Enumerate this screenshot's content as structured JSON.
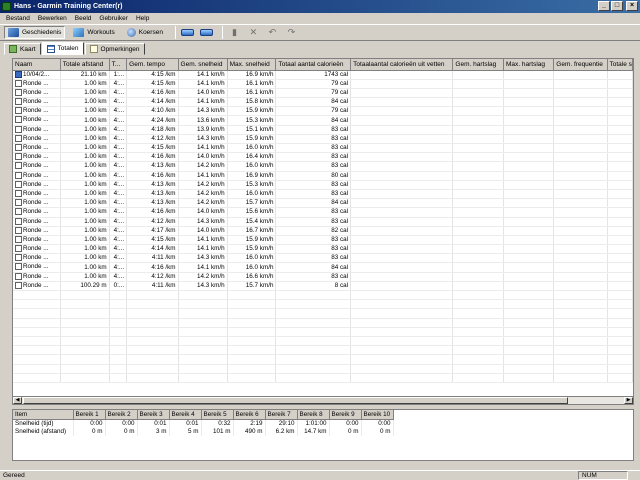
{
  "window": {
    "title": "Hans - Garmin Training Center(r)"
  },
  "menu": [
    "Bestand",
    "Bewerken",
    "Beeld",
    "Gebruiker",
    "Help"
  ],
  "toolbar": {
    "history": "Geschiedenis",
    "workouts": "Workouts",
    "courses": "Koersen"
  },
  "subtabs": [
    "Kaart",
    "Totalen",
    "Opmerkingen"
  ],
  "lap_table": {
    "columns": [
      "Naam",
      "Totale afstand",
      "T...",
      "Gem. tempo",
      "Gem. snelheid",
      "Max. snelheid",
      "Totaal aantal calorieën",
      "Totaalaantal calorieën uit vetten",
      "Gem. hartslag",
      "Max. hartslag",
      "Gem. frequentie",
      "Totale s"
    ],
    "rows": [
      [
        "10/04/2...",
        "21.10 km",
        "1:...",
        "4:15 /km",
        "14.1 km/h",
        "16.9 km/h",
        "1743 cal"
      ],
      [
        "Ronde ...",
        "1.00 km",
        "4:...",
        "4:15 /km",
        "14.1 km/h",
        "16.1 km/h",
        "79 cal"
      ],
      [
        "Ronde ...",
        "1.00 km",
        "4:...",
        "4:16 /km",
        "14.0 km/h",
        "16.1 km/h",
        "79 cal"
      ],
      [
        "Ronde ...",
        "1.00 km",
        "4:...",
        "4:14 /km",
        "14.1 km/h",
        "15.8 km/h",
        "84 cal"
      ],
      [
        "Ronde ...",
        "1.00 km",
        "4:...",
        "4:10 /km",
        "14.3 km/h",
        "15.9 km/h",
        "79 cal"
      ],
      [
        "Ronde ...",
        "1.00 km",
        "4:...",
        "4:24 /km",
        "13.6 km/h",
        "15.3 km/h",
        "84 cal"
      ],
      [
        "Ronde ...",
        "1.00 km",
        "4:...",
        "4:18 /km",
        "13.9 km/h",
        "15.1 km/h",
        "83 cal"
      ],
      [
        "Ronde ...",
        "1.00 km",
        "4:...",
        "4:12 /km",
        "14.3 km/h",
        "15.9 km/h",
        "83 cal"
      ],
      [
        "Ronde ...",
        "1.00 km",
        "4:...",
        "4:15 /km",
        "14.1 km/h",
        "16.0 km/h",
        "83 cal"
      ],
      [
        "Ronde ...",
        "1.00 km",
        "4:...",
        "4:16 /km",
        "14.0 km/h",
        "16.4 km/h",
        "83 cal"
      ],
      [
        "Ronde ...",
        "1.00 km",
        "4:...",
        "4:13 /km",
        "14.2 km/h",
        "16.0 km/h",
        "83 cal"
      ],
      [
        "Ronde ...",
        "1.00 km",
        "4:...",
        "4:16 /km",
        "14.1 km/h",
        "16.9 km/h",
        "80 cal"
      ],
      [
        "Ronde ...",
        "1.00 km",
        "4:...",
        "4:13 /km",
        "14.2 km/h",
        "15.3 km/h",
        "83 cal"
      ],
      [
        "Ronde ...",
        "1.00 km",
        "4:...",
        "4:13 /km",
        "14.2 km/h",
        "16.0 km/h",
        "83 cal"
      ],
      [
        "Ronde ...",
        "1.00 km",
        "4:...",
        "4:13 /km",
        "14.2 km/h",
        "15.7 km/h",
        "84 cal"
      ],
      [
        "Ronde ...",
        "1.00 km",
        "4:...",
        "4:16 /km",
        "14.0 km/h",
        "15.6 km/h",
        "83 cal"
      ],
      [
        "Ronde ...",
        "1.00 km",
        "4:...",
        "4:12 /km",
        "14.3 km/h",
        "15.4 km/h",
        "83 cal"
      ],
      [
        "Ronde ...",
        "1.00 km",
        "4:...",
        "4:17 /km",
        "14.0 km/h",
        "16.7 km/h",
        "82 cal"
      ],
      [
        "Ronde ...",
        "1.00 km",
        "4:...",
        "4:15 /km",
        "14.1 km/h",
        "15.9 km/h",
        "83 cal"
      ],
      [
        "Ronde ...",
        "1.00 km",
        "4:...",
        "4:14 /km",
        "14.1 km/h",
        "15.9 km/h",
        "83 cal"
      ],
      [
        "Ronde ...",
        "1.00 km",
        "4:...",
        "4:11 /km",
        "14.3 km/h",
        "16.0 km/h",
        "83 cal"
      ],
      [
        "Ronde ...",
        "1.00 km",
        "4:...",
        "4:16 /km",
        "14.1 km/h",
        "16.0 km/h",
        "84 cal"
      ],
      [
        "Ronde ...",
        "1.00 km",
        "4:...",
        "4:12 /km",
        "14.2 km/h",
        "16.6 km/h",
        "83 cal"
      ],
      [
        "Ronde ...",
        "100.29 m",
        "0:...",
        "4:11 /km",
        "14.3 km/h",
        "15.7 km/h",
        "8 cal"
      ]
    ]
  },
  "zones_table": {
    "columns": [
      "Item",
      "Bereik 1",
      "Bereik 2",
      "Bereik 3",
      "Bereik 4",
      "Bereik 5",
      "Bereik 6",
      "Bereik 7",
      "Bereik 8",
      "Bereik 9",
      "Bereik 10"
    ],
    "rows": [
      [
        "Snelheid (tijd)",
        "0:00",
        "0:00",
        "0:01",
        "0:01",
        "0:32",
        "2:19",
        "29:10",
        "1:01:00",
        "0:00",
        "0:00"
      ],
      [
        "Snelheid (afstand)",
        "0 m",
        "0 m",
        "3 m",
        "5 m",
        "101 m",
        "490 m",
        "6.2 km",
        "14.7 km",
        "0 m",
        "0 m"
      ]
    ]
  },
  "status": {
    "text": "Gereed",
    "num": "NUM"
  }
}
